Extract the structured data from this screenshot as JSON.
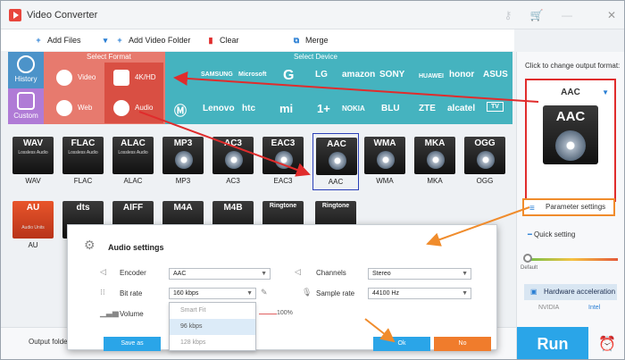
{
  "app": {
    "title": "Video Converter"
  },
  "toolbar": {
    "add_files": "Add Files",
    "add_video_folder": "Add Video Folder",
    "clear": "Clear",
    "merge": "Merge"
  },
  "format_panel": {
    "select_format": "Select Format",
    "select_device": "Select Device",
    "history": "History",
    "custom": "Custom",
    "categories": [
      "Video",
      "4K/HD",
      "Web",
      "Audio"
    ],
    "brands_row1": [
      "SAMSUNG",
      "Microsoft",
      "G",
      "LG",
      "amazon",
      "SONY",
      "HUAWEI",
      "honor",
      "ASUS"
    ],
    "brands_row2": [
      "Motorola",
      "Lenovo",
      "htc",
      "mi",
      "OnePlus",
      "NOKIA",
      "BLU",
      "ZTE",
      "alcatel",
      "TV"
    ]
  },
  "formats_row1": [
    {
      "name": "WAV",
      "sub": "Lossless Audio"
    },
    {
      "name": "FLAC",
      "sub": "Lossless Audio"
    },
    {
      "name": "ALAC",
      "sub": "Lossless Audio"
    },
    {
      "name": "MP3",
      "sub": ""
    },
    {
      "name": "AC3",
      "sub": ""
    },
    {
      "name": "EAC3",
      "sub": ""
    },
    {
      "name": "AAC",
      "sub": ""
    },
    {
      "name": "WMA",
      "sub": ""
    },
    {
      "name": "MKA",
      "sub": ""
    },
    {
      "name": "OGG",
      "sub": ""
    }
  ],
  "formats_row2": [
    {
      "name": "AU",
      "sub": "Audio Units",
      "label": "AU"
    },
    {
      "name": "dts",
      "sub": "",
      "label": ""
    },
    {
      "name": "AIFF",
      "sub": "",
      "label": ""
    },
    {
      "name": "M4A",
      "sub": "",
      "label": ""
    },
    {
      "name": "M4B",
      "sub": "",
      "label": ""
    },
    {
      "name": "Ringtone",
      "sub": "",
      "label": ""
    },
    {
      "name": "Ringtone",
      "sub": "",
      "label": ""
    }
  ],
  "output": {
    "hint": "Click to change output format:",
    "format": "AAC",
    "param_settings": "Parameter settings",
    "quick_setting": "Quick setting",
    "default_label": "Default",
    "hw_accel": "Hardware acceleration",
    "hw_logos": [
      "NVIDIA",
      "Intel"
    ],
    "run": "Run"
  },
  "dialog": {
    "title": "Audio settings",
    "encoder_label": "Encoder",
    "encoder_value": "AAC",
    "bitrate_label": "Bit rate",
    "bitrate_value": "160 kbps",
    "volume_label": "Volume",
    "volume_value": "100%",
    "channels_label": "Channels",
    "channels_value": "Stereo",
    "sample_rate_label": "Sample rate",
    "sample_rate_value": "44100 Hz",
    "bitrate_options": [
      "Smart Fit",
      "96 kbps",
      "128 kbps"
    ],
    "highlighted_option": "96 kbps",
    "save_as": "Save as",
    "ok": "Ok",
    "no": "No"
  },
  "bottom": {
    "output_folder": "Output folder"
  },
  "colors": {
    "accent": "#2aa5e8",
    "panel": "#45b3bf",
    "highlight_red": "#e02c2c",
    "highlight_orange": "#f08c2c"
  }
}
